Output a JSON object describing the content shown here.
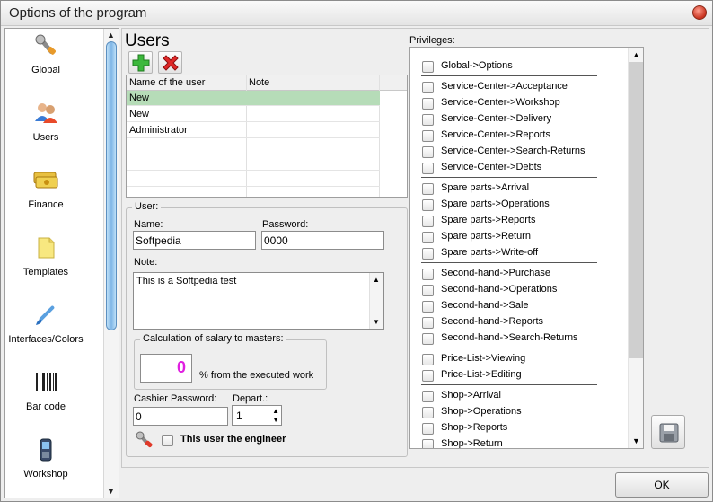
{
  "window": {
    "title": "Options of the program"
  },
  "sidebar": {
    "items": [
      {
        "label": "Global",
        "icon": "wrench-icon"
      },
      {
        "label": "Users",
        "icon": "users-icon"
      },
      {
        "label": "Finance",
        "icon": "money-icon"
      },
      {
        "label": "Templates",
        "icon": "template-icon"
      },
      {
        "label": "Interfaces/Colors",
        "icon": "brush-icon"
      },
      {
        "label": "Bar code",
        "icon": "barcode-icon"
      },
      {
        "label": "Workshop",
        "icon": "phone-icon"
      }
    ]
  },
  "users": {
    "title": "Users",
    "table": {
      "columns": [
        "Name of the user",
        "Note"
      ],
      "rows": [
        {
          "name": "New",
          "note": "",
          "selected": true
        },
        {
          "name": "New",
          "note": ""
        },
        {
          "name": "Administrator",
          "note": ""
        }
      ]
    }
  },
  "user_form": {
    "group_label": "User:",
    "name_label": "Name:",
    "name_value": "Softpedia",
    "password_label": "Password:",
    "password_value": "0000",
    "note_label": "Note:",
    "note_value": "This is a Softpedia test",
    "salary_group_label": "Calculation of salary to masters:",
    "salary_value": "0",
    "salary_suffix": "% from the executed work",
    "cashier_label": "Cashier Password:",
    "cashier_value": "0",
    "depart_label": "Depart.:",
    "depart_value": "1",
    "engineer_label": "This user the engineer"
  },
  "privileges": {
    "label": "Privileges:",
    "groups": [
      [
        "Global->Options"
      ],
      [
        "Service-Center->Acceptance",
        "Service-Center->Workshop",
        "Service-Center->Delivery",
        "Service-Center->Reports",
        "Service-Center->Search-Returns",
        "Service-Center->Debts"
      ],
      [
        "Spare parts->Arrival",
        "Spare parts->Operations",
        "Spare parts->Reports",
        "Spare parts->Return",
        "Spare parts->Write-off"
      ],
      [
        "Second-hand->Purchase",
        "Second-hand->Operations",
        "Second-hand->Sale",
        "Second-hand->Reports",
        "Second-hand->Search-Returns"
      ],
      [
        "Price-List->Viewing",
        "Price-List->Editing"
      ],
      [
        "Shop->Arrival",
        "Shop->Operations",
        "Shop->Reports",
        "Shop->Return"
      ]
    ]
  },
  "buttons": {
    "ok": "OK"
  },
  "colors": {
    "selected_row": "#b6dcb8",
    "salary_value": "#e020e0",
    "scroll_thumb": "#7fb6e6"
  }
}
